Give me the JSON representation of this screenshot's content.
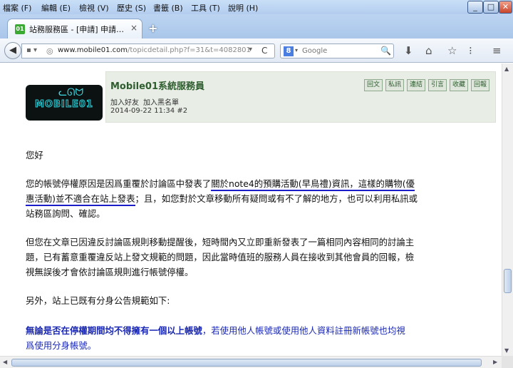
{
  "menubar": {
    "items": [
      "檔案 (F)",
      "編輯 (E)",
      "檢視 (V)",
      "歷史 (S)",
      "書籤 (B)",
      "工具 (T)",
      "說明 (H)"
    ]
  },
  "window_controls": {
    "minimize": "_",
    "maximize": "□",
    "close": "✕"
  },
  "tab": {
    "favicon": "01",
    "title": "站務服務區 - [申請] 申請…",
    "close": "×"
  },
  "newtab": "+",
  "nav": {
    "back": "◀",
    "site_btn": "▪ ▾",
    "globe": "◎",
    "url_host": "www.mobile01.com",
    "url_path": "/topicdetail.php?f=31&t=4082801",
    "dropdown": "▾",
    "reload": "C"
  },
  "search": {
    "engine": "8",
    "caret": "▾",
    "placeholder": "Google",
    "icon": "🔍"
  },
  "toolbar": {
    "download": "⬇",
    "home": "⌂",
    "bookmark": "☆",
    "reading_list": "⁝",
    "menu": "≡"
  },
  "post": {
    "username": "Mobile01系統服務員",
    "add_friend": "加入好友",
    "add_blacklist": "加入黑名單",
    "date": "2014-09-22 11:34",
    "floor": "#2",
    "buttons": [
      "回文",
      "私訊",
      "連結",
      "引言",
      "收藏",
      "回報"
    ],
    "avatar": {
      "logo_text": "MOBILE01",
      "cat": "ᓚᘏᗢ"
    },
    "greeting": "您好",
    "p1": {
      "a": "您的帳號停權原因是因爲重覆於討論區中發表了",
      "b": "關於note4的預購活動(早鳥禮)資訊，這樣的購物(優",
      "c": "惠活動)並不適合在站上發表",
      "d": "；且，如您對於文章移動所有疑問或有不了解的地方，也可以利用私訊或",
      "e": "站務區詢問、確認。"
    },
    "p2": [
      "但您在文章已因違反討論區規則移動提醒後，短時間內又立即重新發表了一篇相同內容相同的討論主",
      "題，已有蓄意重覆違反站上發文規範的問題，因此當時值班的服務人員在接收到其他會員的回報，檢",
      "視無誤後才會依討論區規則進行帳號停權。"
    ],
    "p3": "另外，站上已既有分身公告規範如下:",
    "p4": {
      "bold": "無論是否在停權期間均不得擁有一個以上帳號",
      "rest": "，若使用他人帳號或使用他人資料註冊新帳號也均視",
      "line2": "爲使用分身帳號。"
    }
  },
  "scroll": {
    "up": "▲",
    "down": "▼",
    "left": "◀",
    "right": "▶"
  }
}
